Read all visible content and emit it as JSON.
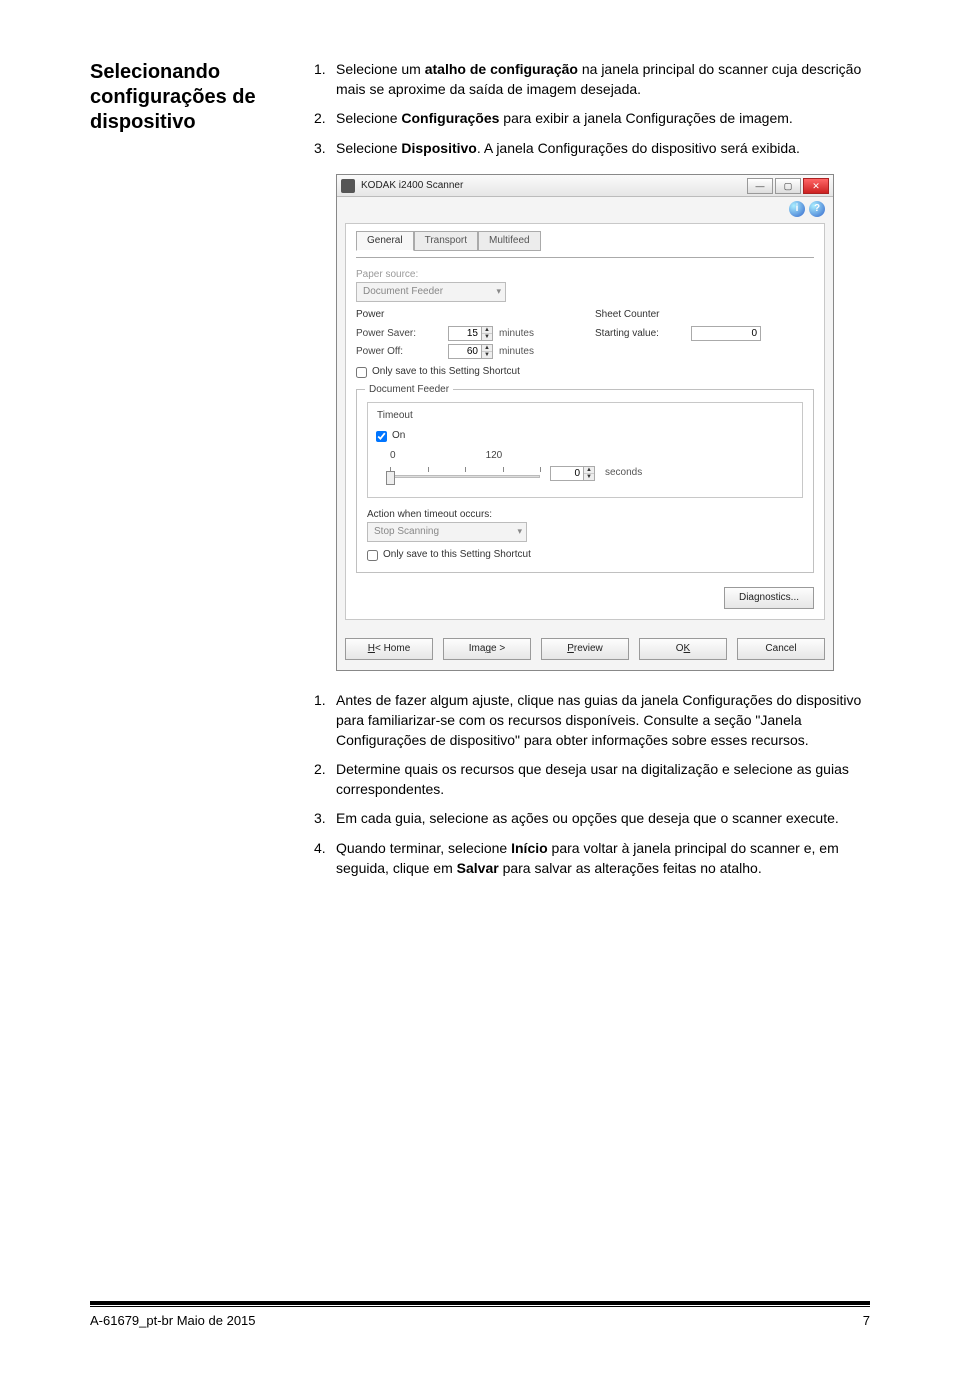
{
  "leftHeading": "Selecionando configurações de dispositivo",
  "steps": {
    "s1a": "Selecione um ",
    "s1b": "atalho de configuração",
    "s1c": " na janela principal do scanner cuja descrição mais se aproxime da saída de imagem desejada.",
    "s2a": "Selecione ",
    "s2b": "Configurações",
    "s2c": " para exibir a janela Configurações de imagem.",
    "s3a": "Selecione ",
    "s3b": "Dispositivo",
    "s3c": ". A janela Configurações do dispositivo será exibida.",
    "s4": "Antes de fazer algum ajuste, clique nas guias da janela Configurações do dispositivo para familiarizar-se com os recursos disponíveis. Consulte a seção \"Janela Configurações de dispositivo\" para obter informações sobre esses recursos.",
    "s5": "Determine quais os recursos que deseja usar na digitalização e selecione as guias correspondentes.",
    "s6": "Em cada guia, selecione as ações ou opções que deseja que o scanner execute.",
    "s7a": "Quando terminar, selecione ",
    "s7b": "Início",
    "s7c": " para voltar à janela principal do scanner e, em seguida, clique em ",
    "s7d": "Salvar",
    "s7e": " para salvar as alterações feitas no atalho."
  },
  "win": {
    "title": "KODAK i2400 Scanner",
    "tabs": {
      "general": "General",
      "transport": "Transport",
      "multifeed": "Multifeed"
    },
    "paperSourceLabel": "Paper source:",
    "paperSourceValue": "Document Feeder",
    "powerTitle": "Power",
    "powerSaverLabel": "Power Saver:",
    "powerSaverValue": "15",
    "powerOffLabel": "Power Off:",
    "powerOffValue": "60",
    "minutes": "minutes",
    "sheetCounterTitle": "Sheet Counter",
    "startingValueLabel": "Starting value:",
    "startingValueValue": "0",
    "onlySave": "Only save to this Setting Shortcut",
    "docFeederTitle": "Document Feeder",
    "timeoutTitle": "Timeout",
    "onLabel": "On",
    "sliderMin": "0",
    "sliderMax": "120",
    "secondsVal": "0",
    "seconds": "seconds",
    "actionLabel": "Action when timeout occurs:",
    "actionValue": "Stop Scanning",
    "diagnostics": "Diagnostics...",
    "btnHome": "< Home",
    "btnImage": "Image >",
    "btnPreview": "Preview",
    "btnOK": "OK",
    "btnCancel": "Cancel"
  },
  "footer": {
    "left": "A-61679_pt-br  Maio de 2015",
    "right": "7"
  }
}
